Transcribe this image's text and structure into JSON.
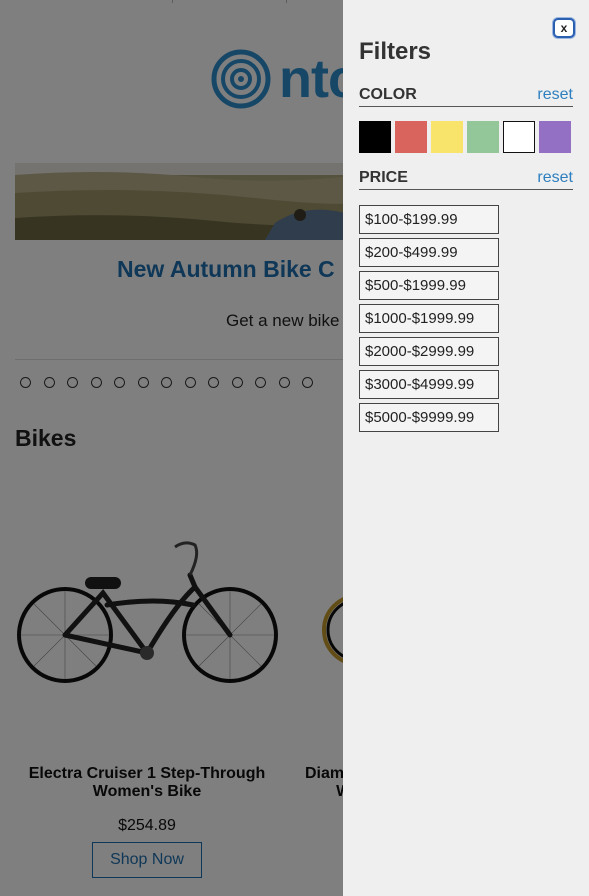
{
  "page": {
    "logo_text": "ntc",
    "hero_title": "New Autumn Bike C",
    "hero_subtitle": "Get a new bike",
    "carousel_dot_count": 13,
    "section_title": "Bikes",
    "products": [
      {
        "name": "Electra Cruiser 1 Step-Through Women's Bike",
        "price": "$254.89",
        "cta": "Shop Now"
      },
      {
        "name": "Diam\nW"
      }
    ]
  },
  "filter_panel": {
    "close_label": "x",
    "title": "Filters",
    "color_section": {
      "label": "COLOR",
      "reset_label": "reset",
      "swatches": [
        {
          "name": "black",
          "color": "#000000"
        },
        {
          "name": "red",
          "color": "#d9645d"
        },
        {
          "name": "yellow",
          "color": "#f8e36b"
        },
        {
          "name": "green",
          "color": "#93c698"
        },
        {
          "name": "white",
          "color": "#ffffff"
        },
        {
          "name": "purple",
          "color": "#9370c3"
        }
      ]
    },
    "price_section": {
      "label": "PRICE",
      "reset_label": "reset",
      "options": [
        "$100-$199.99",
        "$200-$499.99",
        "$500-$1999.99",
        "$1000-$1999.99",
        "$2000-$2999.99",
        "$3000-$4999.99",
        "$5000-$9999.99"
      ]
    }
  },
  "colors": {
    "brand_blue": "#1f6fae",
    "link_blue": "#2e7fbf",
    "panel_bg": "#efefef"
  }
}
